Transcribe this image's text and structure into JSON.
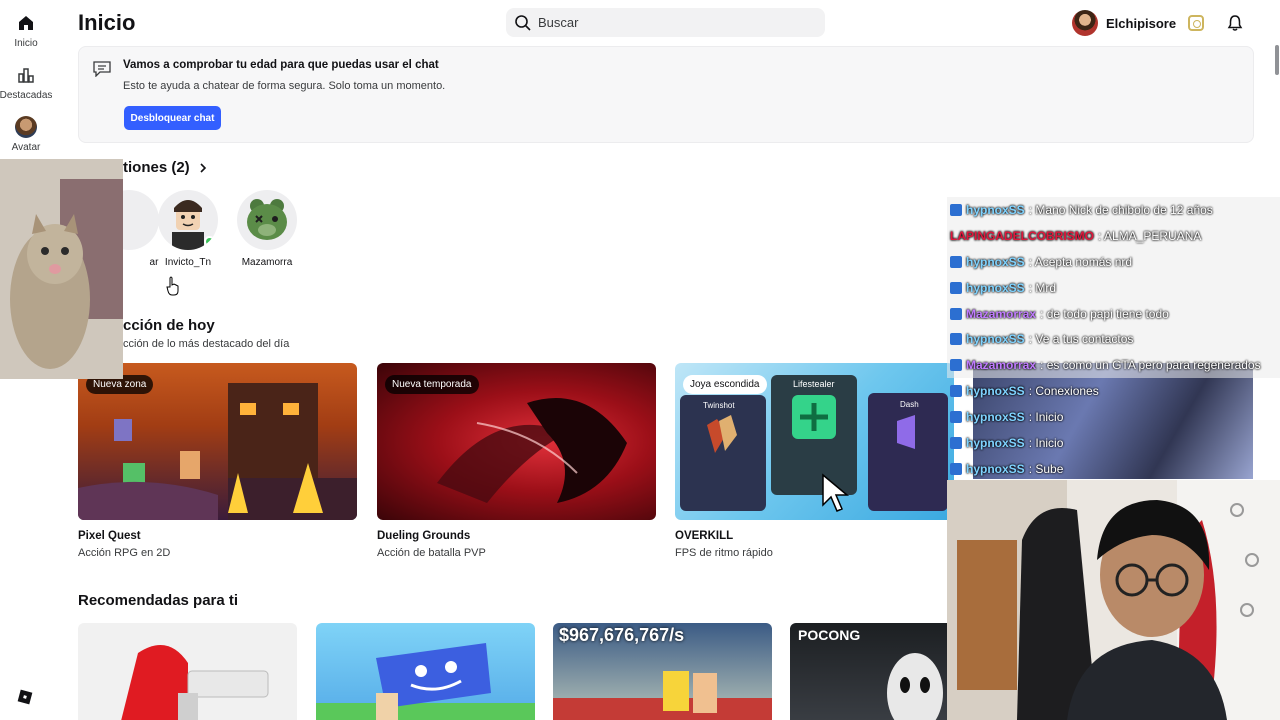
{
  "nav": {
    "items": [
      {
        "label": "Inicio",
        "icon": "home-icon"
      },
      {
        "label": "Destacadas",
        "icon": "charts-icon"
      },
      {
        "label": "Avatar",
        "icon": "avatar-icon"
      }
    ]
  },
  "header": {
    "title": "Inicio",
    "search_placeholder": "Buscar",
    "username": "Elchipisore"
  },
  "banner": {
    "title": "Vamos a comprobar tu edad para que puedas usar el chat",
    "subtitle": "Esto te ayuda a chatear de forma segura. Solo toma un momento.",
    "button": "Desbloquear chat"
  },
  "connections": {
    "title": "tiones (2)",
    "friends": [
      {
        "name": "ar"
      },
      {
        "name": "Invicto_Tn",
        "online": true
      },
      {
        "name": "Mazamorra"
      }
    ]
  },
  "selection": {
    "title": "cción de hoy",
    "subtitle": "cción de lo más destacado del día",
    "games": [
      {
        "badge": "Nueva zona",
        "name": "Pixel Quest",
        "desc": "Acción RPG en 2D"
      },
      {
        "badge": "Nueva temporada",
        "name": "Dueling Grounds",
        "desc": "Acción de batalla PVP"
      },
      {
        "badge": "Joya escondida",
        "name": "OVERKILL",
        "desc": "FPS de ritmo rápido",
        "cards": [
          "Twinshot",
          "Lifestealer",
          "Dash"
        ]
      }
    ]
  },
  "recommended": {
    "title": "Recomendadas para ti",
    "thumb_texts": [
      "$967,676,767/s",
      "POCONG"
    ]
  },
  "chat": [
    {
      "user": "hypnoxSS",
      "color": "#7fd3ff",
      "msg": ": Mano Nick de chibolo de 12 años"
    },
    {
      "user": "LAPINGADELCOBRISMO",
      "color": "#e0173c",
      "msg": ": ALMA_PERUANA"
    },
    {
      "user": "hypnoxSS",
      "color": "#7fd3ff",
      "msg": ": Acepta nomás nrd"
    },
    {
      "user": "hypnoxSS",
      "color": "#7fd3ff",
      "msg": ": Mrd"
    },
    {
      "user": "Mazamorrax",
      "color": "#c07bff",
      "msg": ": de todo papi tiene todo"
    },
    {
      "user": "hypnoxSS",
      "color": "#7fd3ff",
      "msg": ": Ve a tus contactos"
    },
    {
      "user": "Mazamorrax",
      "color": "#c07bff",
      "msg": ": es como un GTA pero para regenerados"
    },
    {
      "user": "hypnoxSS",
      "color": "#7fd3ff",
      "msg": ": Conexiones"
    },
    {
      "user": "hypnoxSS",
      "color": "#7fd3ff",
      "msg": ": Inicio"
    },
    {
      "user": "hypnoxSS",
      "color": "#7fd3ff",
      "msg": ": Inicio"
    },
    {
      "user": "hypnoxSS",
      "color": "#7fd3ff",
      "msg": ": Sube"
    }
  ]
}
